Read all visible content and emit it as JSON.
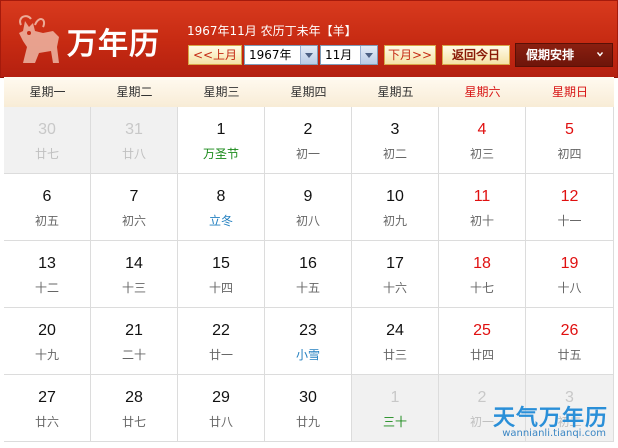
{
  "header": {
    "title": "万年历",
    "lunar_info": "1967年11月 农历丁未年【羊】",
    "prev_label": "<<上月",
    "next_label": "下月>>",
    "today_label": "返回今日",
    "holiday_label": "假期安排",
    "year_value": "1967年",
    "month_value": "11月",
    "accent_color": "#c62a12"
  },
  "weekdays": [
    "星期一",
    "星期二",
    "星期三",
    "星期四",
    "星期五",
    "星期六",
    "星期日"
  ],
  "weeks": [
    [
      {
        "day": "30",
        "lunar": "廿七",
        "other": true
      },
      {
        "day": "31",
        "lunar": "廿八",
        "other": true
      },
      {
        "day": "1",
        "lunar": "万圣节",
        "style": "festival"
      },
      {
        "day": "2",
        "lunar": "初一"
      },
      {
        "day": "3",
        "lunar": "初二"
      },
      {
        "day": "4",
        "lunar": "初三"
      },
      {
        "day": "5",
        "lunar": "初四"
      }
    ],
    [
      {
        "day": "6",
        "lunar": "初五"
      },
      {
        "day": "7",
        "lunar": "初六"
      },
      {
        "day": "8",
        "lunar": "立冬",
        "style": "term"
      },
      {
        "day": "9",
        "lunar": "初八"
      },
      {
        "day": "10",
        "lunar": "初九"
      },
      {
        "day": "11",
        "lunar": "初十"
      },
      {
        "day": "12",
        "lunar": "十一"
      }
    ],
    [
      {
        "day": "13",
        "lunar": "十二"
      },
      {
        "day": "14",
        "lunar": "十三"
      },
      {
        "day": "15",
        "lunar": "十四"
      },
      {
        "day": "16",
        "lunar": "十五"
      },
      {
        "day": "17",
        "lunar": "十六"
      },
      {
        "day": "18",
        "lunar": "十七"
      },
      {
        "day": "19",
        "lunar": "十八"
      }
    ],
    [
      {
        "day": "20",
        "lunar": "十九"
      },
      {
        "day": "21",
        "lunar": "二十"
      },
      {
        "day": "22",
        "lunar": "廿一"
      },
      {
        "day": "23",
        "lunar": "小雪",
        "style": "term"
      },
      {
        "day": "24",
        "lunar": "廿三"
      },
      {
        "day": "25",
        "lunar": "廿四"
      },
      {
        "day": "26",
        "lunar": "廿五"
      }
    ],
    [
      {
        "day": "27",
        "lunar": "廿六"
      },
      {
        "day": "28",
        "lunar": "廿七"
      },
      {
        "day": "29",
        "lunar": "廿八"
      },
      {
        "day": "30",
        "lunar": "廿九"
      },
      {
        "day": "1",
        "lunar": "三十",
        "other": true,
        "style": "festival"
      },
      {
        "day": "2",
        "lunar": "初一",
        "other": true
      },
      {
        "day": "3",
        "lunar": "初二",
        "other": true
      }
    ]
  ],
  "watermark": {
    "text": "天气万年历",
    "url": "wannianli.tianqi.com"
  }
}
